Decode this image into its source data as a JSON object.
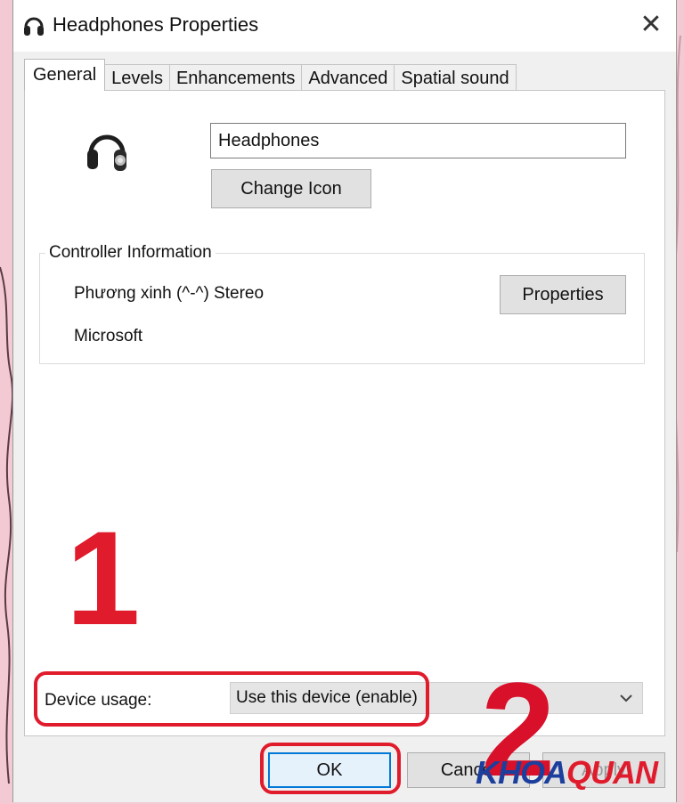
{
  "window": {
    "title": "Headphones Properties",
    "close_glyph": "✕"
  },
  "tabs": [
    {
      "label": "General",
      "active": true
    },
    {
      "label": "Levels",
      "active": false
    },
    {
      "label": "Enhancements",
      "active": false
    },
    {
      "label": "Advanced",
      "active": false
    },
    {
      "label": "Spatial sound",
      "active": false
    }
  ],
  "general": {
    "device_name_value": "Headphones",
    "change_icon_label": "Change Icon",
    "controller": {
      "legend": "Controller Information",
      "name": "Phương xinh (^-^) Stereo",
      "vendor": "Microsoft",
      "properties_label": "Properties"
    },
    "device_usage": {
      "label": "Device usage:",
      "selected": "Use this device (enable)"
    }
  },
  "footer": {
    "ok_label": "OK",
    "cancel_label": "Cancel",
    "apply_label": "Apply"
  },
  "annotations": {
    "step_1": "1",
    "step_2": "2",
    "highlight_color": "#e01b2c"
  },
  "watermark": {
    "part_a": "KHOA",
    "part_b": "QUAN"
  },
  "icons": {
    "title": "headphones-icon",
    "device": "headphones-icon",
    "dropdown": "chevron-down-icon"
  }
}
